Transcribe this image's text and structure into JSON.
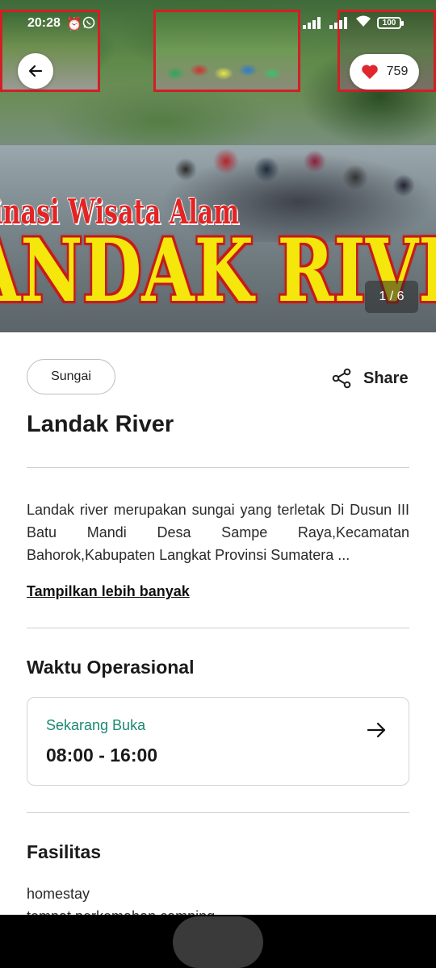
{
  "status_bar": {
    "time": "20:28",
    "battery": "100"
  },
  "hero": {
    "banner_line1": "inasi Wisata Alam",
    "banner_line2": "ANDAK RIVE",
    "image_counter": "1 / 6",
    "like_count": "759"
  },
  "place": {
    "category": "Sungai",
    "share_label": "Share",
    "name": "Landak River",
    "description": "Landak river merupakan sungai yang terletak Di Dusun III Batu Mandi Desa Sampe Raya,Kecamatan Bahorok,Kabupaten Langkat Provinsi Sumatera ...",
    "show_more": "Tampilkan lebih banyak"
  },
  "operating_hours": {
    "section_title": "Waktu Operasional",
    "status": "Sekarang Buka",
    "range": "08:00 - 16:00"
  },
  "facilities": {
    "section_title": "Fasilitas",
    "items": [
      "homestay",
      "tempat perkemahan camping"
    ]
  },
  "colors": {
    "accent_green": "#1b8a72",
    "heart": "#e0262f"
  }
}
